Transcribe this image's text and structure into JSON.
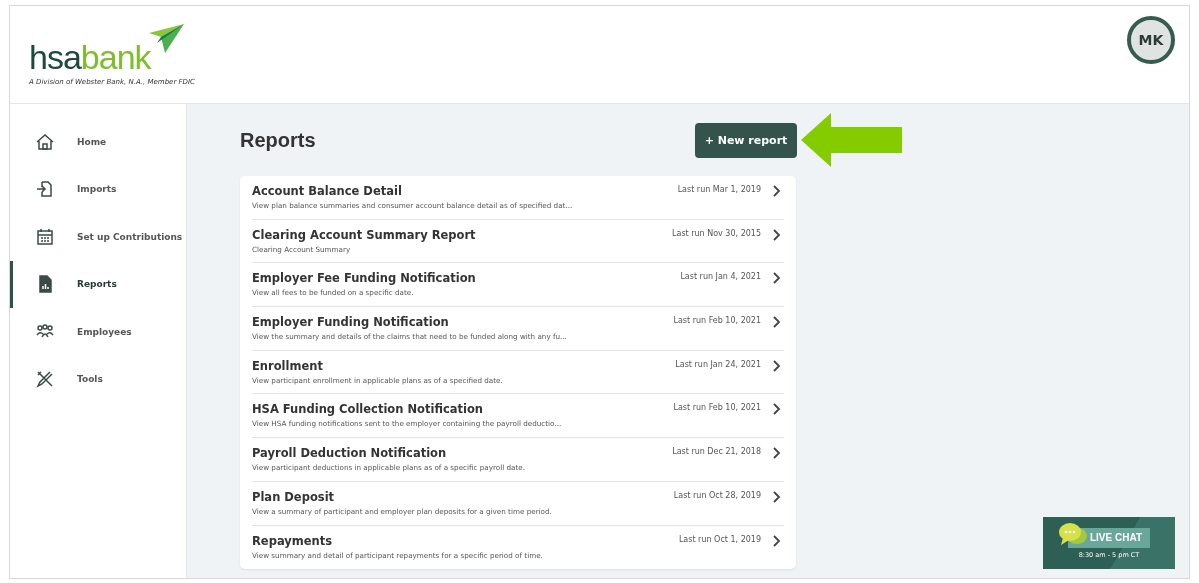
{
  "logo": {
    "part1": "hsa",
    "part2": "bank",
    "tagline": "A Division of Webster Bank, N.A., Member FDIC"
  },
  "user": {
    "initials": "MK"
  },
  "sidebar": {
    "items": [
      {
        "label": "Home",
        "kind": "home",
        "selected": false
      },
      {
        "label": "Imports",
        "kind": "import",
        "selected": false
      },
      {
        "label": "Set up Contributions",
        "kind": "calendar",
        "selected": false
      },
      {
        "label": "Reports",
        "kind": "report",
        "selected": true
      },
      {
        "label": "Employees",
        "kind": "people",
        "selected": false
      },
      {
        "label": "Tools",
        "kind": "tools",
        "selected": false
      }
    ]
  },
  "page": {
    "title": "Reports",
    "new_button": "+ New report"
  },
  "reports": [
    {
      "title": "Account Balance Detail",
      "description": "View plan balance summaries and consumer account balance detail as of specified dat...",
      "last_run": "Last run Mar 1, 2019"
    },
    {
      "title": "Clearing Account Summary Report",
      "description": "Clearing Account Summary",
      "last_run": "Last run Nov 30, 2015"
    },
    {
      "title": "Employer Fee Funding Notification",
      "description": "View all fees to be funded on a specific date.",
      "last_run": "Last run Jan 4, 2021"
    },
    {
      "title": "Employer Funding Notification",
      "description": "View the summary and details of the claims that need to be funded along with any fu...",
      "last_run": "Last run Feb 10, 2021"
    },
    {
      "title": "Enrollment",
      "description": "View participant enrollment in applicable plans as of a specified date.",
      "last_run": "Last run Jan 24, 2021"
    },
    {
      "title": "HSA Funding Collection Notification",
      "description": "View HSA funding notifications sent to the employer containing the payroll deductio...",
      "last_run": "Last run Feb 10, 2021"
    },
    {
      "title": "Payroll Deduction Notification",
      "description": "View participant deductions in applicable plans as of a specific payroll date.",
      "last_run": "Last run Dec 21, 2018"
    },
    {
      "title": "Plan Deposit",
      "description": "View a summary of participant and employer plan deposits for a given time period.",
      "last_run": "Last run Oct 28, 2019"
    },
    {
      "title": "Repayments",
      "description": "View summary and detail of participant repayments for a specific period of time.",
      "last_run": "Last run Oct 1, 2019"
    }
  ],
  "live_chat": {
    "label": "LIVE CHAT",
    "hours": "8:30 am - 5 pm CT"
  }
}
